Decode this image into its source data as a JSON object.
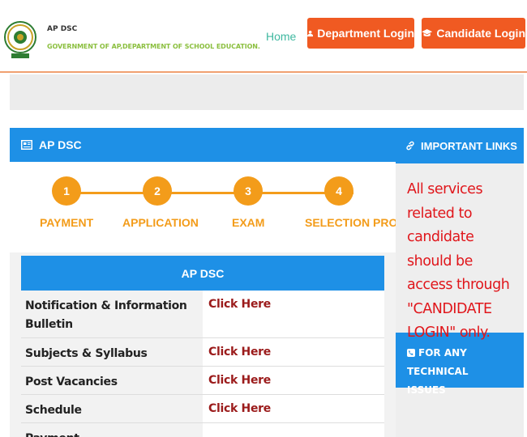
{
  "header": {
    "brand_title": "AP DSC",
    "brand_subtitle": "GOVERNMENT OF AP,DEPARTMENT OF SCHOOL EDUCATION.",
    "nav_home": "Home",
    "department_login": "Department Login",
    "candidate_login": "Candidate Login"
  },
  "left_panel": {
    "title": "AP DSC",
    "steps": [
      {
        "number": "1",
        "label": "PAYMENT"
      },
      {
        "number": "2",
        "label": "APPLICATION"
      },
      {
        "number": "3",
        "label": "EXAM"
      },
      {
        "number": "4",
        "label": "SELECTION PROCESS"
      }
    ],
    "table": {
      "title": "AP DSC",
      "rows": [
        {
          "label": "Notification & Information Bulletin",
          "link": "Click Here"
        },
        {
          "label": "Subjects & Syllabus",
          "link": "Click Here"
        },
        {
          "label": "Post Vacancies",
          "link": "Click Here"
        },
        {
          "label": "Schedule",
          "link": "Click Here"
        },
        {
          "label": "Payment",
          "link": ""
        }
      ]
    }
  },
  "right_panel": {
    "title": "IMPORTANT LINKS",
    "notice": "All services related to candidate should be access through \"CANDIDATE LOGIN\" only.",
    "tech_support": "FOR ANY TECHNICAL ISSUES"
  },
  "colors": {
    "primary_blue": "#1e90e6",
    "login_orange": "#f05a22",
    "step_orange": "#f39c1a",
    "link_maroon": "#9b1b1b",
    "notice_red": "#e0161b"
  },
  "icons": [
    "emblem-logo",
    "user-icon",
    "graduation-cap-icon",
    "newspaper-icon",
    "link-icon",
    "phone-icon"
  ]
}
